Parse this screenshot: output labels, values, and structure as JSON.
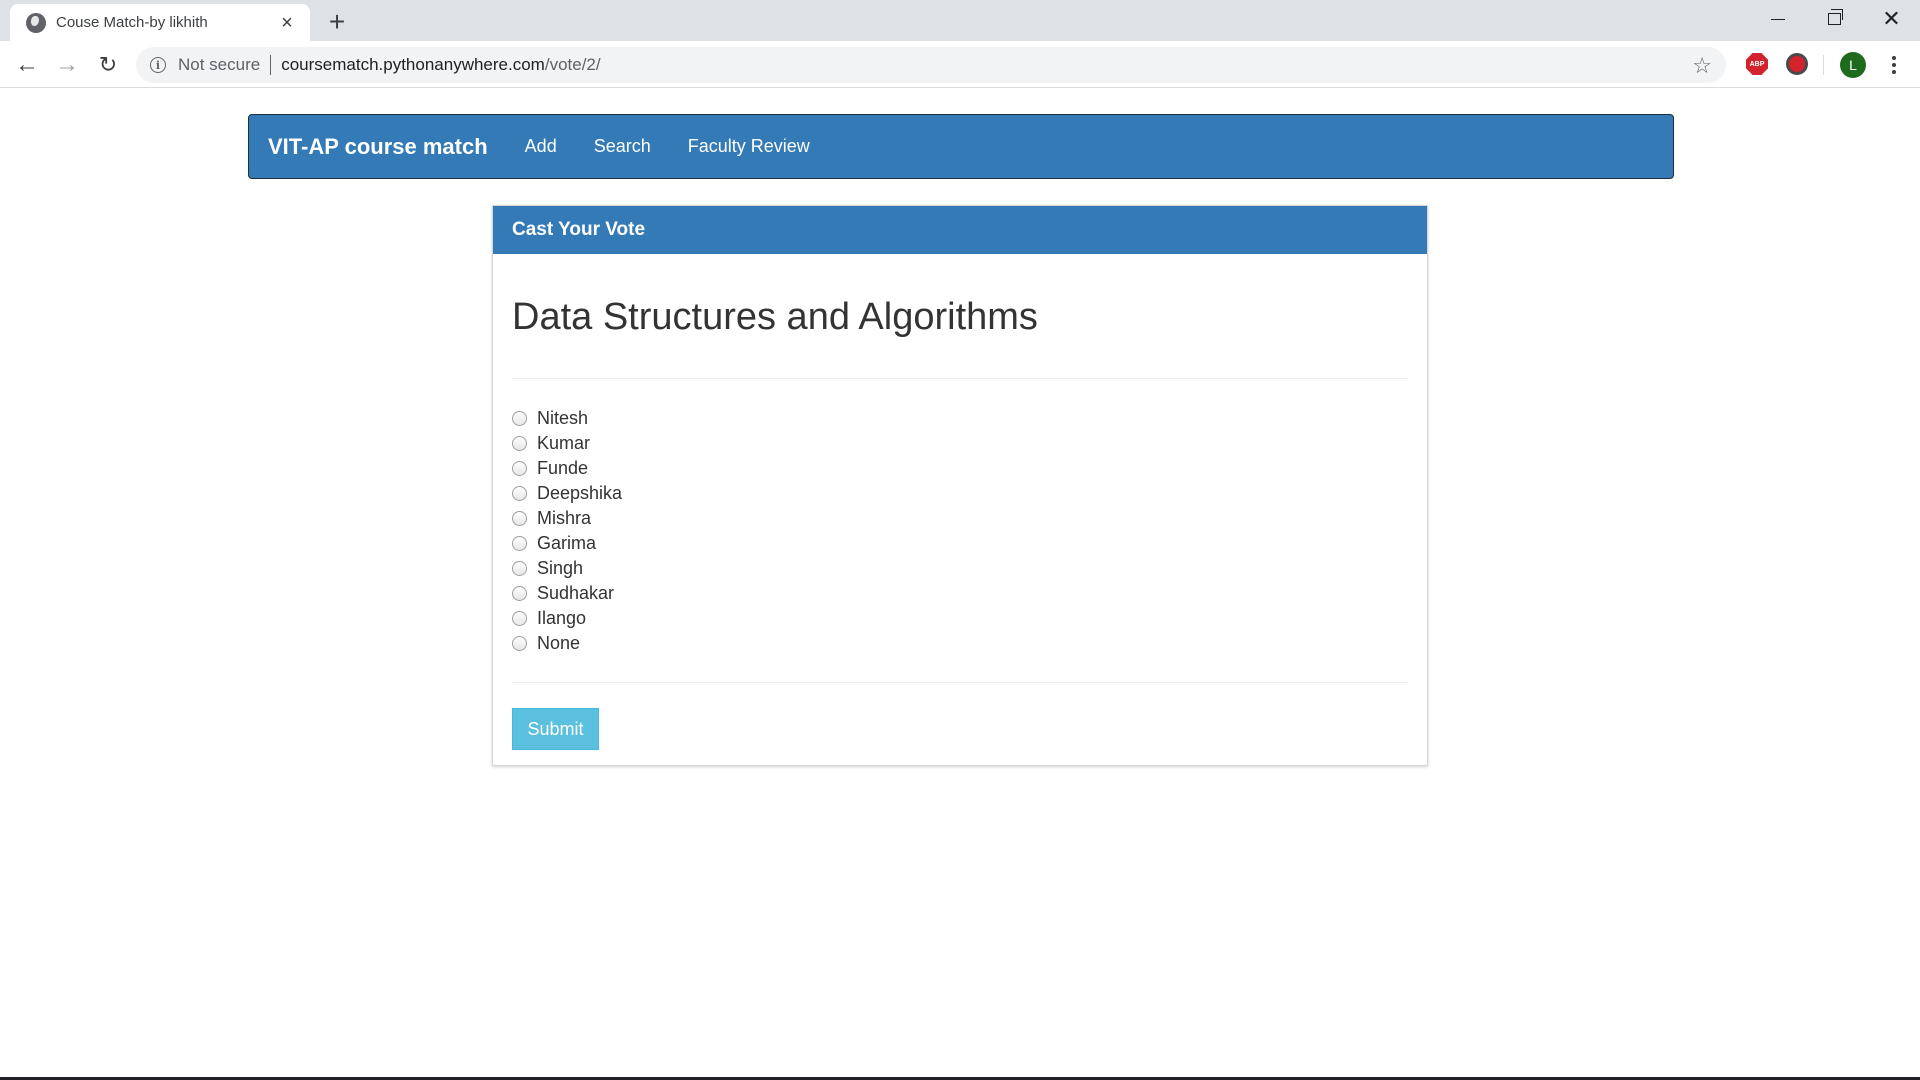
{
  "browser": {
    "tab_title": "Couse Match-by likhith",
    "security_label": "Not secure",
    "url_host": "coursematch.pythonanywhere.com",
    "url_path": "/vote/2/",
    "profile_initial": "L",
    "extensions": [
      "adblock-icon",
      "record-icon"
    ]
  },
  "navbar": {
    "brand": "VIT-AP course match",
    "links": [
      "Add",
      "Search",
      "Faculty Review"
    ],
    "color": "#337ab7"
  },
  "panel": {
    "heading": "Cast Your Vote",
    "course_title": "Data Structures and Algorithms",
    "choices": [
      "Nitesh",
      "Kumar",
      "Funde",
      "Deepshika",
      "Mishra",
      "Garima",
      "Singh",
      "Sudhakar",
      "Ilango",
      "None"
    ],
    "selected_choice": null,
    "submit_label": "Submit",
    "submit_color": "#5bc0de"
  }
}
